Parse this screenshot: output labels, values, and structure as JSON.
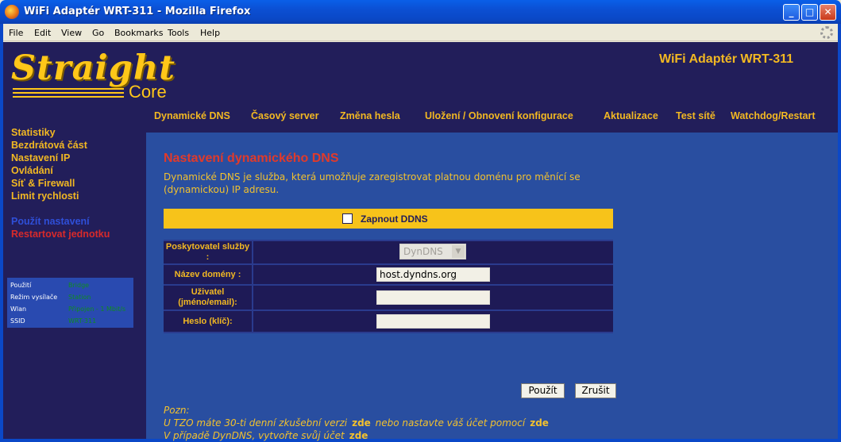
{
  "window": {
    "title": "WiFi Adaptér WRT-311 - Mozilla Firefox",
    "menu": [
      "File",
      "Edit",
      "View",
      "Go",
      "Bookmarks",
      "Tools",
      "Help"
    ]
  },
  "logo": {
    "main": "Straight",
    "sub": "Core"
  },
  "product_title": "WiFi Adaptér WRT-311",
  "topnav": [
    "Dynamické DNS",
    "Časový server",
    "Změna hesla",
    "Uložení / Obnovení konfigurace",
    "Aktualizace",
    "Test sítě",
    "Watchdog/Restart"
  ],
  "sidebar": {
    "items": [
      "Statistiky",
      "Bezdrátová část",
      "Nastavení IP",
      "Ovládání",
      "Síť & Firewall",
      "Limit rychlosti"
    ],
    "apply": "Použít nastavení",
    "restart": "Restartovat jednotku"
  },
  "status": [
    {
      "key": "Použití",
      "value": "Bridge"
    },
    {
      "key": "Režim vysílače",
      "value": "Station"
    },
    {
      "key": "Wlan",
      "value": "Připojen - 1 Mbit/s"
    },
    {
      "key": "SSID",
      "value": "WRT-311"
    }
  ],
  "page": {
    "heading": "Nastavení dynamického DNS",
    "description": "Dynamické DNS je služba, která umožňuje zaregistrovat platnou doménu pro měnící se (dynamickou) IP adresu.",
    "enable_label": "Zapnout DDNS",
    "enable_checked": false,
    "fields": {
      "provider_label": "Poskytovatel služby :",
      "provider_value": "DynDNS",
      "domain_label": "Název domény :",
      "domain_value": "host.dyndns.org",
      "user_label": "Uživatel (jméno/email):",
      "user_value": "",
      "password_label": "Heslo (klíč):",
      "password_value": ""
    },
    "buttons": {
      "apply": "Použít",
      "cancel": "Zrušit"
    },
    "note": {
      "label": "Pozn:",
      "line1": "U TZO máte 30-ti denní zkušební verzi",
      "line1_link1": "zde",
      "line1_mid": "nebo nastavte váš účet pomocí",
      "line1_link2": "zde",
      "line2": "V případě DynDNS, vytvořte svůj účet",
      "line2_link": "zde"
    }
  },
  "colors": {
    "frame": "#221E5A",
    "panel": "#294EA0",
    "accent": "#F2B822",
    "heading": "#E13A2A"
  }
}
